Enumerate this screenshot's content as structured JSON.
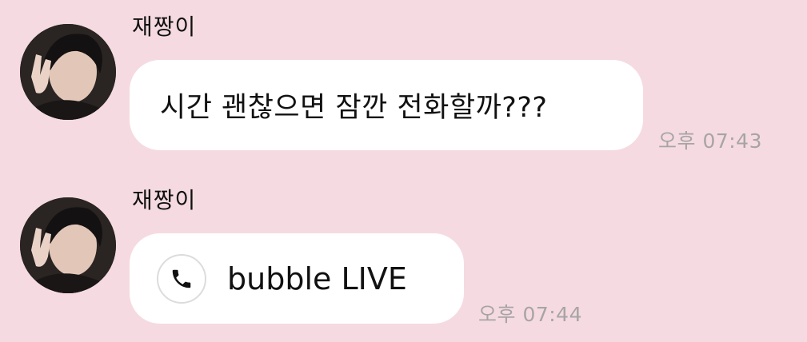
{
  "chat": {
    "messages": [
      {
        "sender": "재짱이",
        "text": "시간 괜찮으면 잠깐 전화할까???",
        "time": "오후 07:43"
      },
      {
        "sender": "재짱이",
        "call_label": "bubble LIVE",
        "call_icon": "phone-icon",
        "time": "오후 07:44"
      }
    ]
  },
  "colors": {
    "background": "#f5dbe1",
    "bubble": "#ffffff",
    "timestamp": "#a8a4a6"
  }
}
